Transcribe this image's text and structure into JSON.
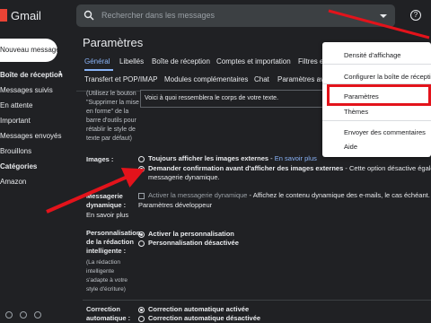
{
  "app": {
    "logo_text": "Gmail"
  },
  "search": {
    "placeholder": "Rechercher dans les messages"
  },
  "sidebar": {
    "compose_label": "Nouveau message",
    "items": [
      {
        "label": "Boîte de réception",
        "count": "1",
        "bold": true
      },
      {
        "label": "Messages suivis",
        "count": "",
        "bold": false
      },
      {
        "label": "En attente",
        "count": "",
        "bold": false
      },
      {
        "label": "Important",
        "count": "",
        "bold": false
      },
      {
        "label": "Messages envoyés",
        "count": "",
        "bold": false
      },
      {
        "label": "Brouillons",
        "count": "",
        "bold": false
      },
      {
        "label": "Catégories",
        "count": "",
        "bold": true
      },
      {
        "label": "Amazon",
        "count": "",
        "bold": false
      }
    ]
  },
  "main": {
    "title": "Paramètres",
    "tabs_row1": [
      "Général",
      "Libellés",
      "Boîte de réception",
      "Comptes et importation",
      "Filtres e"
    ],
    "tabs_row2": [
      "Transfert et POP/IMAP",
      "Modules complémentaires",
      "Chat",
      "Paramètres av"
    ],
    "signature_help": [
      "(Utilisez le bouton",
      "\"Supprimer la mise",
      "en forme\" de la",
      "barre d'outils pour",
      "rétablir le style de",
      "texte par défaut)"
    ],
    "signature_preview": "Voici à quoi ressemblera le corps de votre texte.",
    "images": {
      "label": "Images :",
      "opt1": "Toujours afficher les images externes",
      "opt1_link": "En savoir plus",
      "opt2": "Demander confirmation avant d'afficher des images externes",
      "opt2_desc": " - Cette option désactive égaleme",
      "opt2_cont": "messagerie dynamique."
    },
    "dynamic": {
      "label1": "Messagerie",
      "label2": "dynamique :",
      "link": "En savoir plus",
      "checkbox_label": "Activer la messagerie dynamique",
      "desc": " - Affichez le contenu dynamique des e-mails, le cas échéant.",
      "dev_link": "Paramètres développeur"
    },
    "smart": {
      "label_lines": [
        "Personnalisation",
        "de la rédaction",
        "intelligente :"
      ],
      "sub_lines": [
        "(La rédaction",
        "intelligente",
        "s'adapte à votre",
        "style d'écriture)"
      ],
      "opt1": "Activer la personnalisation",
      "opt2": "Personnalisation désactivée"
    },
    "autocorrect": {
      "label_lines": [
        "Correction",
        "automatique :"
      ],
      "opt1": "Correction automatique activée",
      "opt2": "Correction automatique désactivée"
    }
  },
  "menu": {
    "items": [
      "Densité d'affichage",
      "Configurer la boîte de réceptio",
      "Paramètres",
      "Thèmes",
      "Envoyer des commentaires",
      "Aide"
    ]
  },
  "colors": {
    "accent": "#8ab4f8",
    "annotation": "#e3131b",
    "background": "#202124"
  }
}
